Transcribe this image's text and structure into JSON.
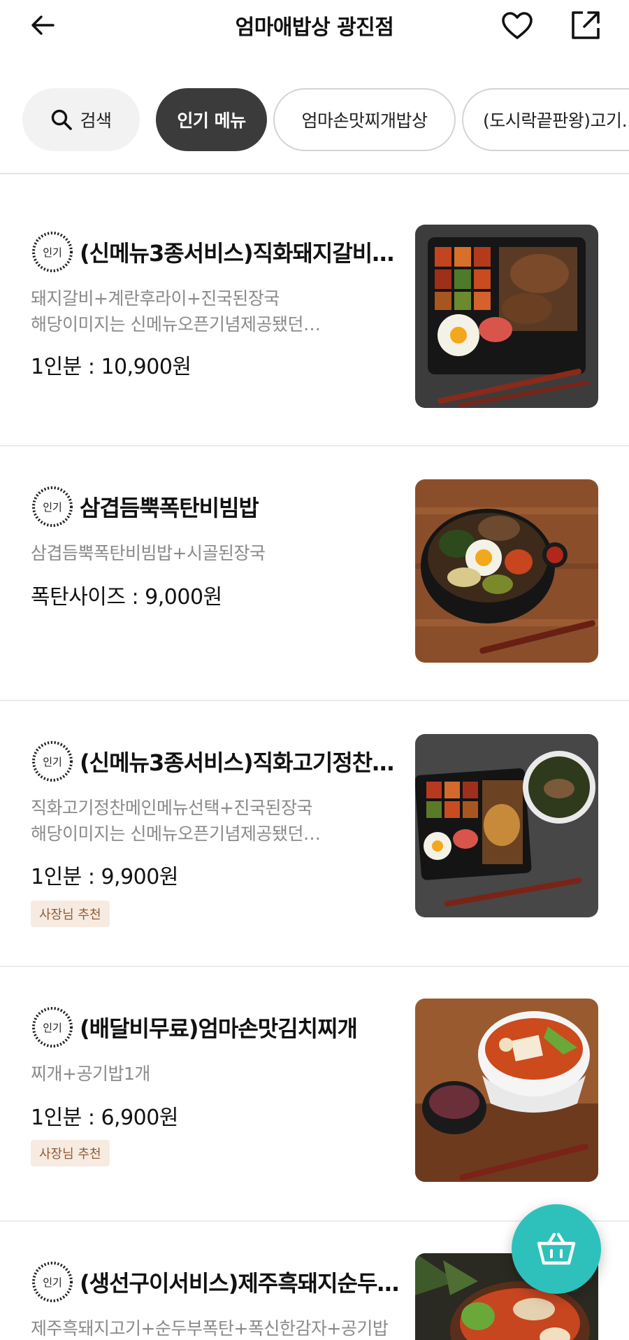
{
  "header": {
    "title": "엄마애밥상 광진점",
    "icons": {
      "back": "back-arrow-icon",
      "favorite": "heart-icon",
      "share": "share-icon"
    }
  },
  "tabs": [
    {
      "label": "검색",
      "icon": "search-icon"
    },
    {
      "label": "인기 메뉴",
      "selected": true
    },
    {
      "label": "엄마손맛찌개밥상"
    },
    {
      "label": "(도시락끝판왕)고기…"
    }
  ],
  "badge_text": "인기",
  "menu": {
    "items": [
      {
        "name": "(신메뉴3종서비스)직화돼지갈비…",
        "desc": [
          "돼지갈비+계란후라이+진국된장국",
          "해당이미지는 신메뉴오픈기념제공됐던…"
        ],
        "price": "1인분 : 10,900원",
        "tag": ""
      },
      {
        "name": "삼겹듬뿍폭탄비빔밥",
        "desc": [
          "삼겹듬뿍폭탄비빔밥+시골된장국"
        ],
        "price": "폭탄사이즈 : 9,000원",
        "tag": ""
      },
      {
        "name": "(신메뉴3종서비스)직화고기정찬…",
        "desc": [
          "직화고기정찬메인메뉴선택+진국된장국",
          "해당이미지는 신메뉴오픈기념제공됐던…"
        ],
        "price": "1인분 : 9,900원",
        "tag": "사장님 추천"
      },
      {
        "name": "(배달비무료)엄마손맛김치찌개",
        "desc": [
          "찌개+공기밥1개"
        ],
        "price": "1인분 : 6,900원",
        "tag": "사장님 추천"
      },
      {
        "name": "(생선구이서비스)제주흑돼지순두…",
        "desc": [
          "제주흑돼지고기+순두부폭탄+폭신한감자+공기밥"
        ],
        "price": "",
        "tag": ""
      }
    ]
  },
  "cart": {
    "icon": "cart-basket-icon"
  },
  "colors": {
    "accent": "#2ec1bc",
    "tab_selected": "#3b3b3b",
    "tag_bg": "#f7ebe1",
    "tag_text": "#8e5a37"
  }
}
